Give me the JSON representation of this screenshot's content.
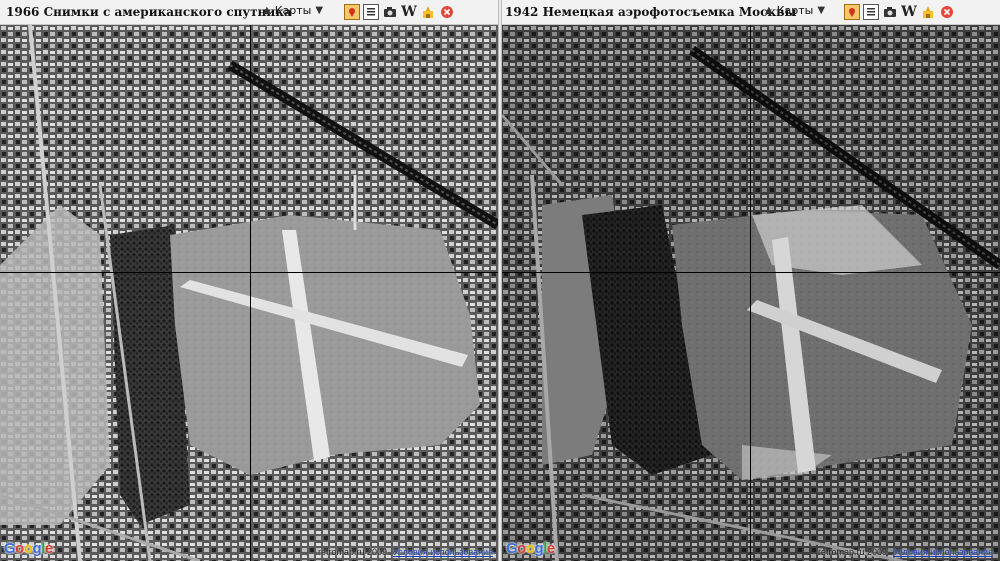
{
  "left_panel": {
    "title": "1966 Снимки с американского спутника",
    "maps_label": "Карты",
    "credit": "retromap.ru 2009",
    "terms_link": "Условия использования",
    "logo": {
      "letters": [
        "G",
        "o",
        "o",
        "g",
        "l",
        "e"
      ]
    }
  },
  "right_panel": {
    "title": "1942 Немецкая аэрофотосъемка Москвы",
    "maps_label": "Карты",
    "credit": "retromap.ru 2009",
    "terms_link": "Условия использования",
    "logo": {
      "letters": [
        "G",
        "o",
        "o",
        "g",
        "l",
        "e"
      ]
    }
  },
  "toolbar_icons": [
    "map-marker-icon",
    "document-icon",
    "camera-icon",
    "wikipedia-icon",
    "landmark-icon",
    "close-circle-icon"
  ],
  "colors": {
    "toolbar_bg": "#f2f2f2",
    "terms_link": "#1a3fb3"
  }
}
